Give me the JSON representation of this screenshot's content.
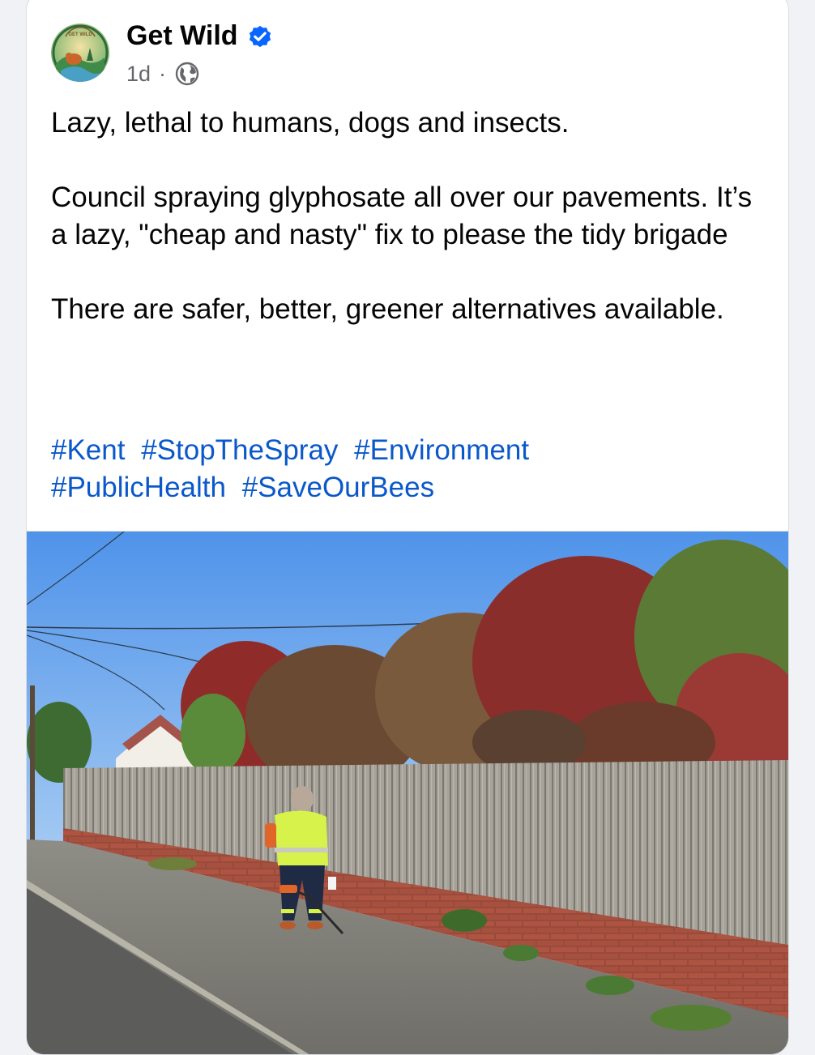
{
  "post": {
    "author": "Get Wild",
    "verified_icon": "verified-badge-icon",
    "timestamp": "1d",
    "separator": "·",
    "audience_icon": "globe-icon",
    "avatar_text": "GET WILD",
    "paragraphs": [
      "Lazy, lethal to humans, dogs and insects.",
      "Council spraying glyphosate all over our pavements. It’s a lazy, \"cheap and nasty\" fix to please the tidy brigade",
      "There are safer, better, greener alternatives available."
    ],
    "hashtags": [
      "#Kent",
      "#StopTheSpray",
      "#Environment",
      "#PublicHealth",
      "#SaveOurBees"
    ]
  },
  "colors": {
    "hashtag": "#0a58ca",
    "verified": "#0866ff",
    "meta": "#65676b",
    "text": "#050505"
  }
}
